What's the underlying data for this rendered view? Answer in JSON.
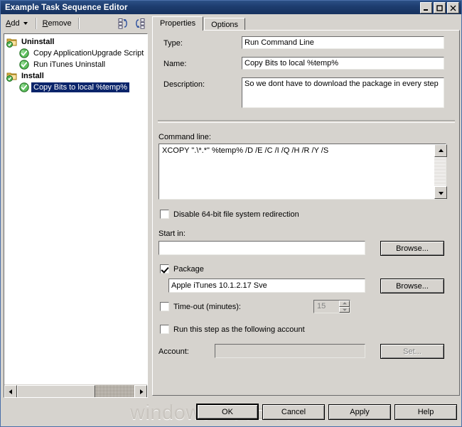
{
  "window": {
    "title": "Example Task Sequence Editor",
    "buttons": {
      "minimize": "_",
      "maximize": "□",
      "close": "✕"
    }
  },
  "toolbar": {
    "add_label": "Add",
    "add_accel": "A",
    "remove_label": "Remove",
    "remove_accel": "R",
    "icon_collapse": "collapse-all-icon",
    "icon_expand": "expand-all-icon"
  },
  "tree": {
    "nodes": [
      {
        "label": "Uninstall",
        "type": "group",
        "icon": "folder-step-icon",
        "selected": false,
        "indent": 0
      },
      {
        "label": "Copy ApplicationUpgrade Script",
        "type": "step",
        "icon": "green-check-icon",
        "selected": false,
        "indent": 1
      },
      {
        "label": "Run iTunes Uninstall",
        "type": "step",
        "icon": "green-check-icon",
        "selected": false,
        "indent": 1
      },
      {
        "label": "Install",
        "type": "group",
        "icon": "folder-step-icon",
        "selected": false,
        "indent": 0
      },
      {
        "label": "Copy Bits to local %temp%",
        "type": "step",
        "icon": "green-check-icon",
        "selected": true,
        "indent": 1
      }
    ],
    "scroll_left": "◀",
    "scroll_right": "▶"
  },
  "tabs": [
    {
      "label": "Properties",
      "active": true
    },
    {
      "label": "Options",
      "active": false
    }
  ],
  "properties": {
    "type_label": "Type:",
    "type_value": "Run Command Line",
    "name_label": "Name:",
    "name_value": "Copy Bits to local %temp%",
    "description_label": "Description:",
    "description_value": "So we dont have to download the package in every step",
    "command_line_label": "Command line:",
    "command_line_value": "XCOPY \".\\*.*\" %temp% /D /E /C /I /Q /H /R /Y /S",
    "disable_redirection_label": "Disable 64-bit file system redirection",
    "disable_redirection_checked": false,
    "start_in_label": "Start in:",
    "start_in_value": "",
    "start_in_browse_label": "Browse...",
    "package_label": "Package",
    "package_checked": true,
    "package_value": "Apple iTunes 10.1.2.17 Sve",
    "package_browse_label": "Browse...",
    "timeout_label": "Time-out (minutes):",
    "timeout_checked": false,
    "timeout_value": "15",
    "timeout_up": "▲",
    "timeout_down": "▼",
    "run_as_label": "Run this step as the following account",
    "run_as_checked": false,
    "account_label": "Account:",
    "account_value": "",
    "account_set_label": "Set...",
    "scroll_up": "▲",
    "scroll_down": "▼"
  },
  "footer": {
    "ok_label": "OK",
    "cancel_label": "Cancel",
    "apply_label": "Apply",
    "help_label": "Help"
  },
  "watermark": {
    "text": "windows-noob.com"
  }
}
